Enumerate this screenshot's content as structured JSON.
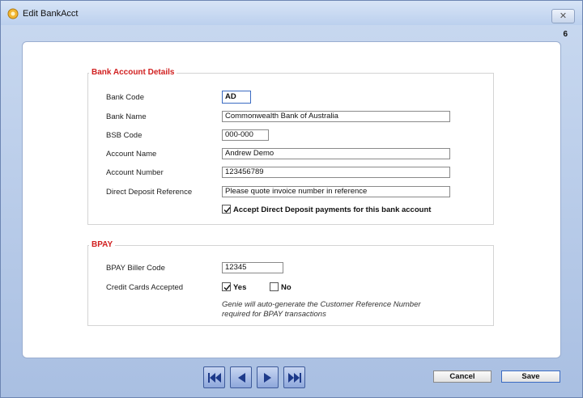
{
  "window": {
    "title": "Edit BankAcct",
    "close_glyph": "✕",
    "record_number": "6"
  },
  "bank_section": {
    "legend": "Bank Account Details",
    "fields": {
      "bank_code": {
        "label": "Bank Code",
        "value": "AD"
      },
      "bank_name": {
        "label": "Bank Name",
        "value": "Commonwealth Bank of Australia"
      },
      "bsb_code": {
        "label": "BSB Code",
        "value": "000-000"
      },
      "account_name": {
        "label": "Account Name",
        "value": "Andrew Demo"
      },
      "account_number": {
        "label": "Account Number",
        "value": "123456789"
      },
      "dd_reference": {
        "label": "Direct Deposit Reference",
        "value": "Please quote invoice number in reference"
      }
    },
    "accept_dd": {
      "label": "Accept Direct Deposit payments for this bank account",
      "checked": true
    }
  },
  "bpay_section": {
    "legend": "BPAY",
    "biller_code": {
      "label": "BPAY Biller Code",
      "value": "12345"
    },
    "credit_cards": {
      "label": "Credit Cards Accepted",
      "yes": {
        "label": "Yes",
        "checked": true
      },
      "no": {
        "label": "No",
        "checked": false
      }
    },
    "note_line1": "Genie will auto-generate the Customer Reference Number",
    "note_line2": "required for BPAY transactions"
  },
  "footer": {
    "nav_icons": [
      "first-record-icon",
      "previous-record-icon",
      "next-record-icon",
      "last-record-icon"
    ],
    "cancel_label": "Cancel",
    "save_label": "Save"
  },
  "colors": {
    "legend": "#d12020",
    "accent": "#3b6bc2"
  }
}
